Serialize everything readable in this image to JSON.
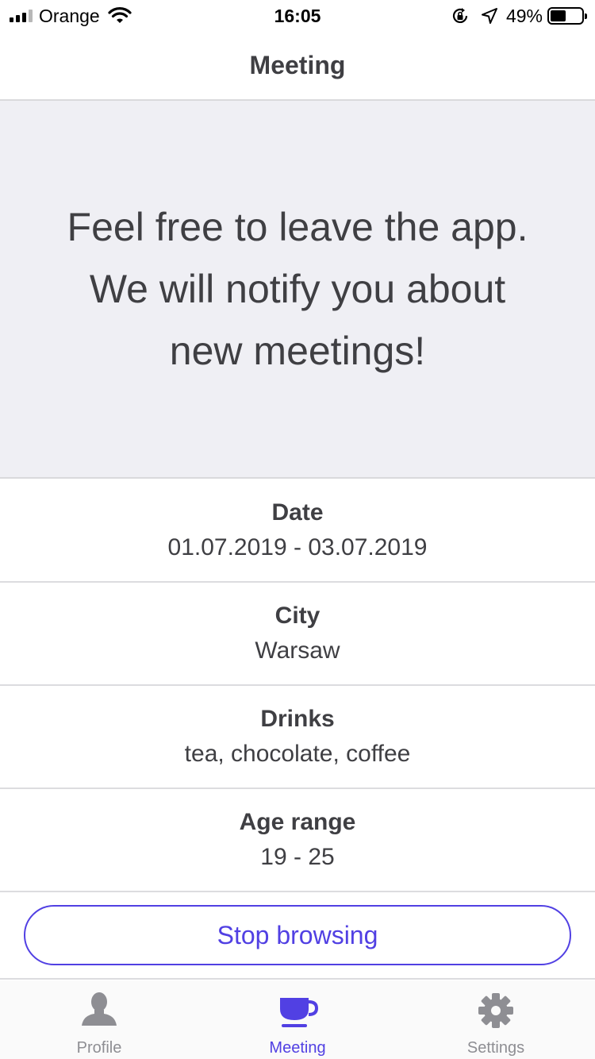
{
  "status_bar": {
    "carrier": "Orange",
    "time": "16:05",
    "battery_percent": "49%",
    "battery_level": 0.49,
    "icons": [
      "signal-icon",
      "wifi-icon",
      "rotation-lock-icon",
      "location-arrow-icon",
      "battery-icon"
    ]
  },
  "nav": {
    "title": "Meeting"
  },
  "banner": {
    "line1": "Feel free to leave the app.",
    "line2": "We will notify you about",
    "line3": "new meetings!"
  },
  "info": {
    "date": {
      "label": "Date",
      "value": "01.07.2019 - 03.07.2019"
    },
    "city": {
      "label": "City",
      "value": "Warsaw"
    },
    "drinks": {
      "label": "Drinks",
      "value": "tea, chocolate, coffee"
    },
    "age": {
      "label": "Age range",
      "value": "19 - 25"
    }
  },
  "stop_button": {
    "label": "Stop browsing"
  },
  "tabs": [
    {
      "label": "Profile",
      "icon": "person-icon",
      "active": false
    },
    {
      "label": "Meeting",
      "icon": "cup-icon",
      "active": true
    },
    {
      "label": "Settings",
      "icon": "gear-icon",
      "active": false
    }
  ],
  "colors": {
    "accent": "#5140e3",
    "banner_bg": "#efeff4",
    "text": "#3f3f43",
    "inactive_tab": "#8e8e93"
  }
}
